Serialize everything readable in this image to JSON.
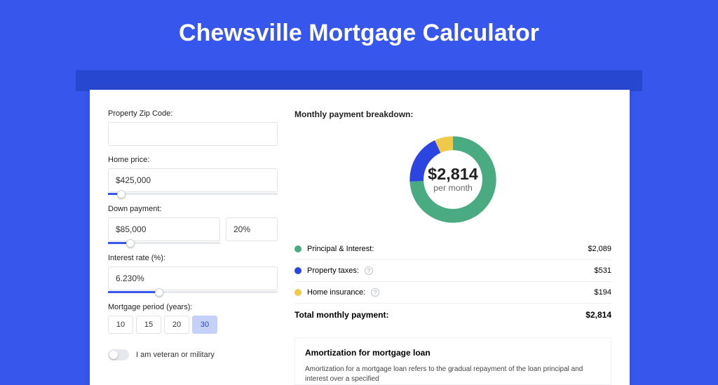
{
  "title": "Chewsville Mortgage Calculator",
  "form": {
    "zip_label": "Property Zip Code:",
    "zip_value": "",
    "home_price_label": "Home price:",
    "home_price_value": "$425,000",
    "home_price_pct": 8,
    "down_payment_label": "Down payment:",
    "down_payment_value": "$85,000",
    "down_payment_percent": "20%",
    "down_payment_pct": 20,
    "interest_label": "Interest rate (%):",
    "interest_value": "6.230%",
    "interest_pct": 30,
    "period_label": "Mortgage period (years):",
    "periods": [
      "10",
      "15",
      "20",
      "30"
    ],
    "period_active": "30",
    "veteran_label": "I am veteran or military"
  },
  "breakdown": {
    "title": "Monthly payment breakdown:",
    "amount": "$2,814",
    "per_month": "per month",
    "items": [
      {
        "label": "Principal & Interest:",
        "value": "$2,089",
        "value_num": 2089,
        "color": "#4aab83",
        "info": false
      },
      {
        "label": "Property taxes:",
        "value": "$531",
        "value_num": 531,
        "color": "#2d45e0",
        "info": true
      },
      {
        "label": "Home insurance:",
        "value": "$194",
        "value_num": 194,
        "color": "#f0c94a",
        "info": true
      }
    ],
    "total_label": "Total monthly payment:",
    "total_value": "$2,814"
  },
  "amort": {
    "title": "Amortization for mortgage loan",
    "body": "Amortization for a mortgage loan refers to the gradual repayment of the loan principal and interest over a specified"
  },
  "chart_data": {
    "type": "pie",
    "title": "Monthly payment breakdown",
    "series": [
      {
        "name": "Principal & Interest",
        "value": 2089,
        "color": "#4aab83"
      },
      {
        "name": "Property taxes",
        "value": 531,
        "color": "#2d45e0"
      },
      {
        "name": "Home insurance",
        "value": 194,
        "color": "#f0c94a"
      }
    ],
    "center_label": "$2,814",
    "center_sublabel": "per month",
    "total": 2814
  }
}
